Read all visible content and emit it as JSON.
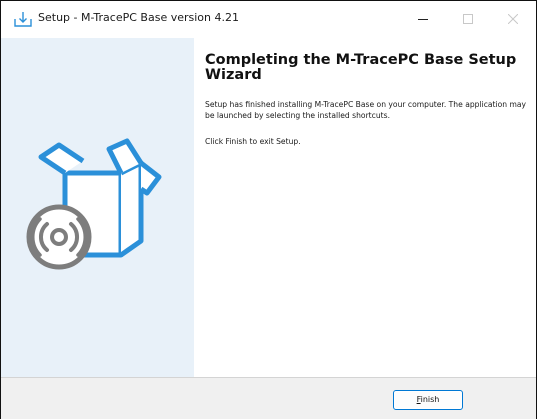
{
  "window": {
    "title": "Setup - M-TracePC Base version 4.21"
  },
  "content": {
    "heading": "Completing the M-TracePC Base Setup Wizard",
    "paragraph_1": "Setup has finished installing M-TracePC Base on your computer. The application may be launched by selecting the installed shortcuts.",
    "paragraph_2": "Click Finish to exit Setup."
  },
  "footer": {
    "finish_mnemonic": "F",
    "finish_rest": "inish"
  },
  "colors": {
    "accent": "#0078d4",
    "sidebar_bg": "#e8f1f9",
    "box_blue": "#2b90d9",
    "disc_gray": "#7d7d7d"
  }
}
